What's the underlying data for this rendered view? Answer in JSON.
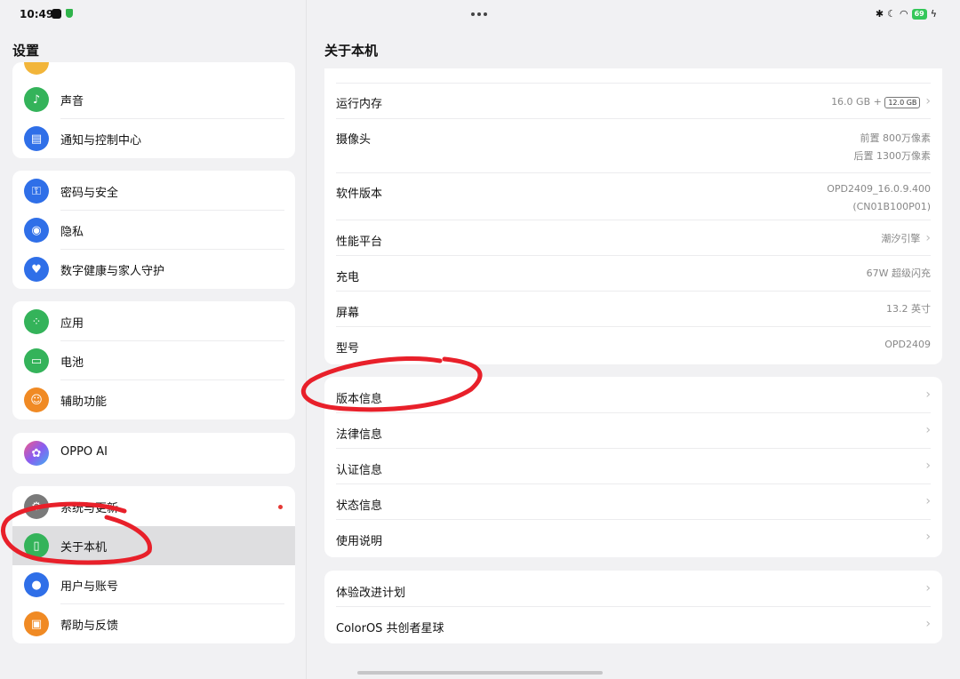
{
  "status_bar": {
    "time": "10:49",
    "battery": "69",
    "icons": [
      "bluetooth-icon",
      "moon-icon",
      "wifi-icon",
      "charging-icon"
    ]
  },
  "left": {
    "title": "设置",
    "groups": [
      {
        "items": [
          {
            "label": "声音",
            "icon": "speaker-icon",
            "color": "#34b35a"
          },
          {
            "label": "通知与控制中心",
            "icon": "notification-icon",
            "color": "#2f6fe8"
          }
        ]
      },
      {
        "items": [
          {
            "label": "密码与安全",
            "icon": "key-icon",
            "color": "#2f6fe8"
          },
          {
            "label": "隐私",
            "icon": "privacy-icon",
            "color": "#2f6fe8"
          },
          {
            "label": "数字健康与家人守护",
            "icon": "family-icon",
            "color": "#2f6fe8"
          }
        ]
      },
      {
        "items": [
          {
            "label": "应用",
            "icon": "apps-icon",
            "color": "#34b35a"
          },
          {
            "label": "电池",
            "icon": "battery-icon",
            "color": "#34b35a"
          },
          {
            "label": "辅助功能",
            "icon": "accessibility-icon",
            "color": "#f08a24"
          }
        ]
      },
      {
        "items": [
          {
            "label": "OPPO AI",
            "icon": "ai-icon",
            "color": "#a05cd6"
          }
        ]
      },
      {
        "items": [
          {
            "label": "系统与更新",
            "icon": "gear-icon",
            "color": "#7a7a7a"
          },
          {
            "label": "关于本机",
            "icon": "phone-icon",
            "color": "#34b35a"
          },
          {
            "label": "用户与账号",
            "icon": "user-icon",
            "color": "#2f6fe8"
          },
          {
            "label": "帮助与反馈",
            "icon": "help-icon",
            "color": "#f08a24"
          }
        ]
      }
    ]
  },
  "right": {
    "title": "关于本机",
    "specs": [
      {
        "label": "运行内存",
        "value": "16.0 GB +",
        "badge": "12.0 GB",
        "chevron": true
      },
      {
        "label": "摄像头",
        "value": "前置 800万像素",
        "value2": "后置 1300万像素"
      },
      {
        "label": "软件版本",
        "value": "OPD2409_16.0.9.400",
        "value2": "(CN01B100P01)"
      },
      {
        "label": "性能平台",
        "value": "潮汐引擎",
        "chevron": true
      },
      {
        "label": "充电",
        "value": "67W 超级闪充"
      },
      {
        "label": "屏幕",
        "value": "13.2 英寸"
      },
      {
        "label": "型号",
        "value": "OPD2409"
      }
    ],
    "info": [
      "版本信息",
      "法律信息",
      "认证信息",
      "状态信息",
      "使用说明"
    ],
    "extra": [
      "体验改进计划",
      "ColorOS 共创者星球"
    ]
  }
}
